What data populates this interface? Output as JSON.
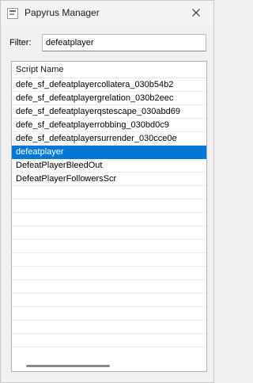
{
  "window": {
    "title": "Papyrus Manager"
  },
  "filter": {
    "label": "Filter:",
    "value": "defeatplayer"
  },
  "list": {
    "header": "Script Name",
    "rows": [
      "defe_sf_defeatplayercollatera_030b54b2",
      "defe_sf_defeatplayergrelation_030b2eec",
      "defe_sf_defeatplayerqstescape_030abd69",
      "defe_sf_defeatplayerrobbing_030bd0c9",
      "defe_sf_defeatplayersurrender_030cce0e",
      "defeatplayer",
      "DefeatPlayerBleedOut",
      "DefeatPlayerFollowersScr"
    ],
    "selected_index": 5
  },
  "colors": {
    "selection": "#0078d7"
  }
}
